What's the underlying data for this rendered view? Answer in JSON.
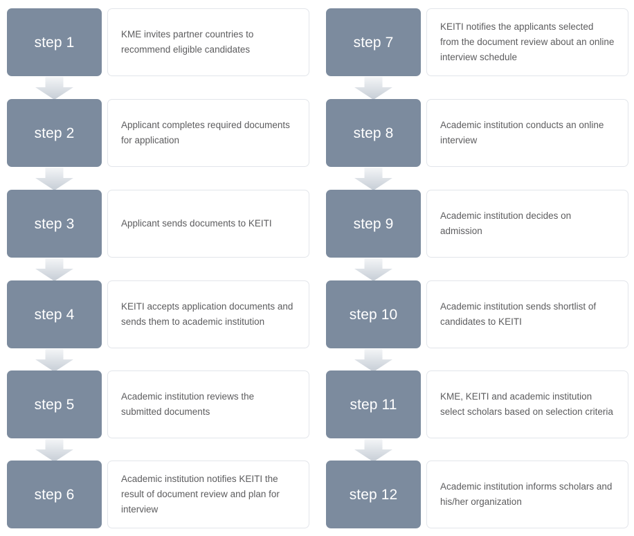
{
  "diagram": {
    "title": "KEITI scholarship application process flowchart",
    "colors": {
      "step_box": "#7c8b9e",
      "step_label_text": "#ffffff",
      "card_background": "#ffffff",
      "card_border": "#e2e5ea",
      "card_text": "#5c5c5e",
      "arrow_light": "#f2f4f6",
      "arrow_dark": "#c7ced6",
      "page_background": "#ffffff"
    },
    "arrow_icon_name": "down-arrow-icon",
    "columns": [
      {
        "name": "left-column",
        "steps": [
          {
            "label": "step 1",
            "description": "KME invites partner countries to recommend eligible candidates"
          },
          {
            "label": "step 2",
            "description": "Applicant completes required documents for application"
          },
          {
            "label": "step 3",
            "description": "Applicant sends documents to KEITI"
          },
          {
            "label": "step 4",
            "description": "KEITI accepts application documents and sends them to academic institution"
          },
          {
            "label": "step 5",
            "description": "Academic institution reviews the submitted documents"
          },
          {
            "label": "step 6",
            "description": "Academic institution notifies KEITI the result of document review and plan for interview"
          }
        ]
      },
      {
        "name": "right-column",
        "steps": [
          {
            "label": "step 7",
            "description": "KEITI notifies the applicants selected from the document review about an online interview schedule"
          },
          {
            "label": "step 8",
            "description": "Academic institution conducts an online interview"
          },
          {
            "label": "step 9",
            "description": "Academic institution decides on admission"
          },
          {
            "label": "step 10",
            "description": "Academic institution sends shortlist of candidates to KEITI"
          },
          {
            "label": "step 11",
            "description": "KME, KEITI and academic institution select scholars based on selection criteria"
          },
          {
            "label": "step 12",
            "description": "Academic institution informs scholars and his/her organization"
          }
        ]
      }
    ]
  }
}
